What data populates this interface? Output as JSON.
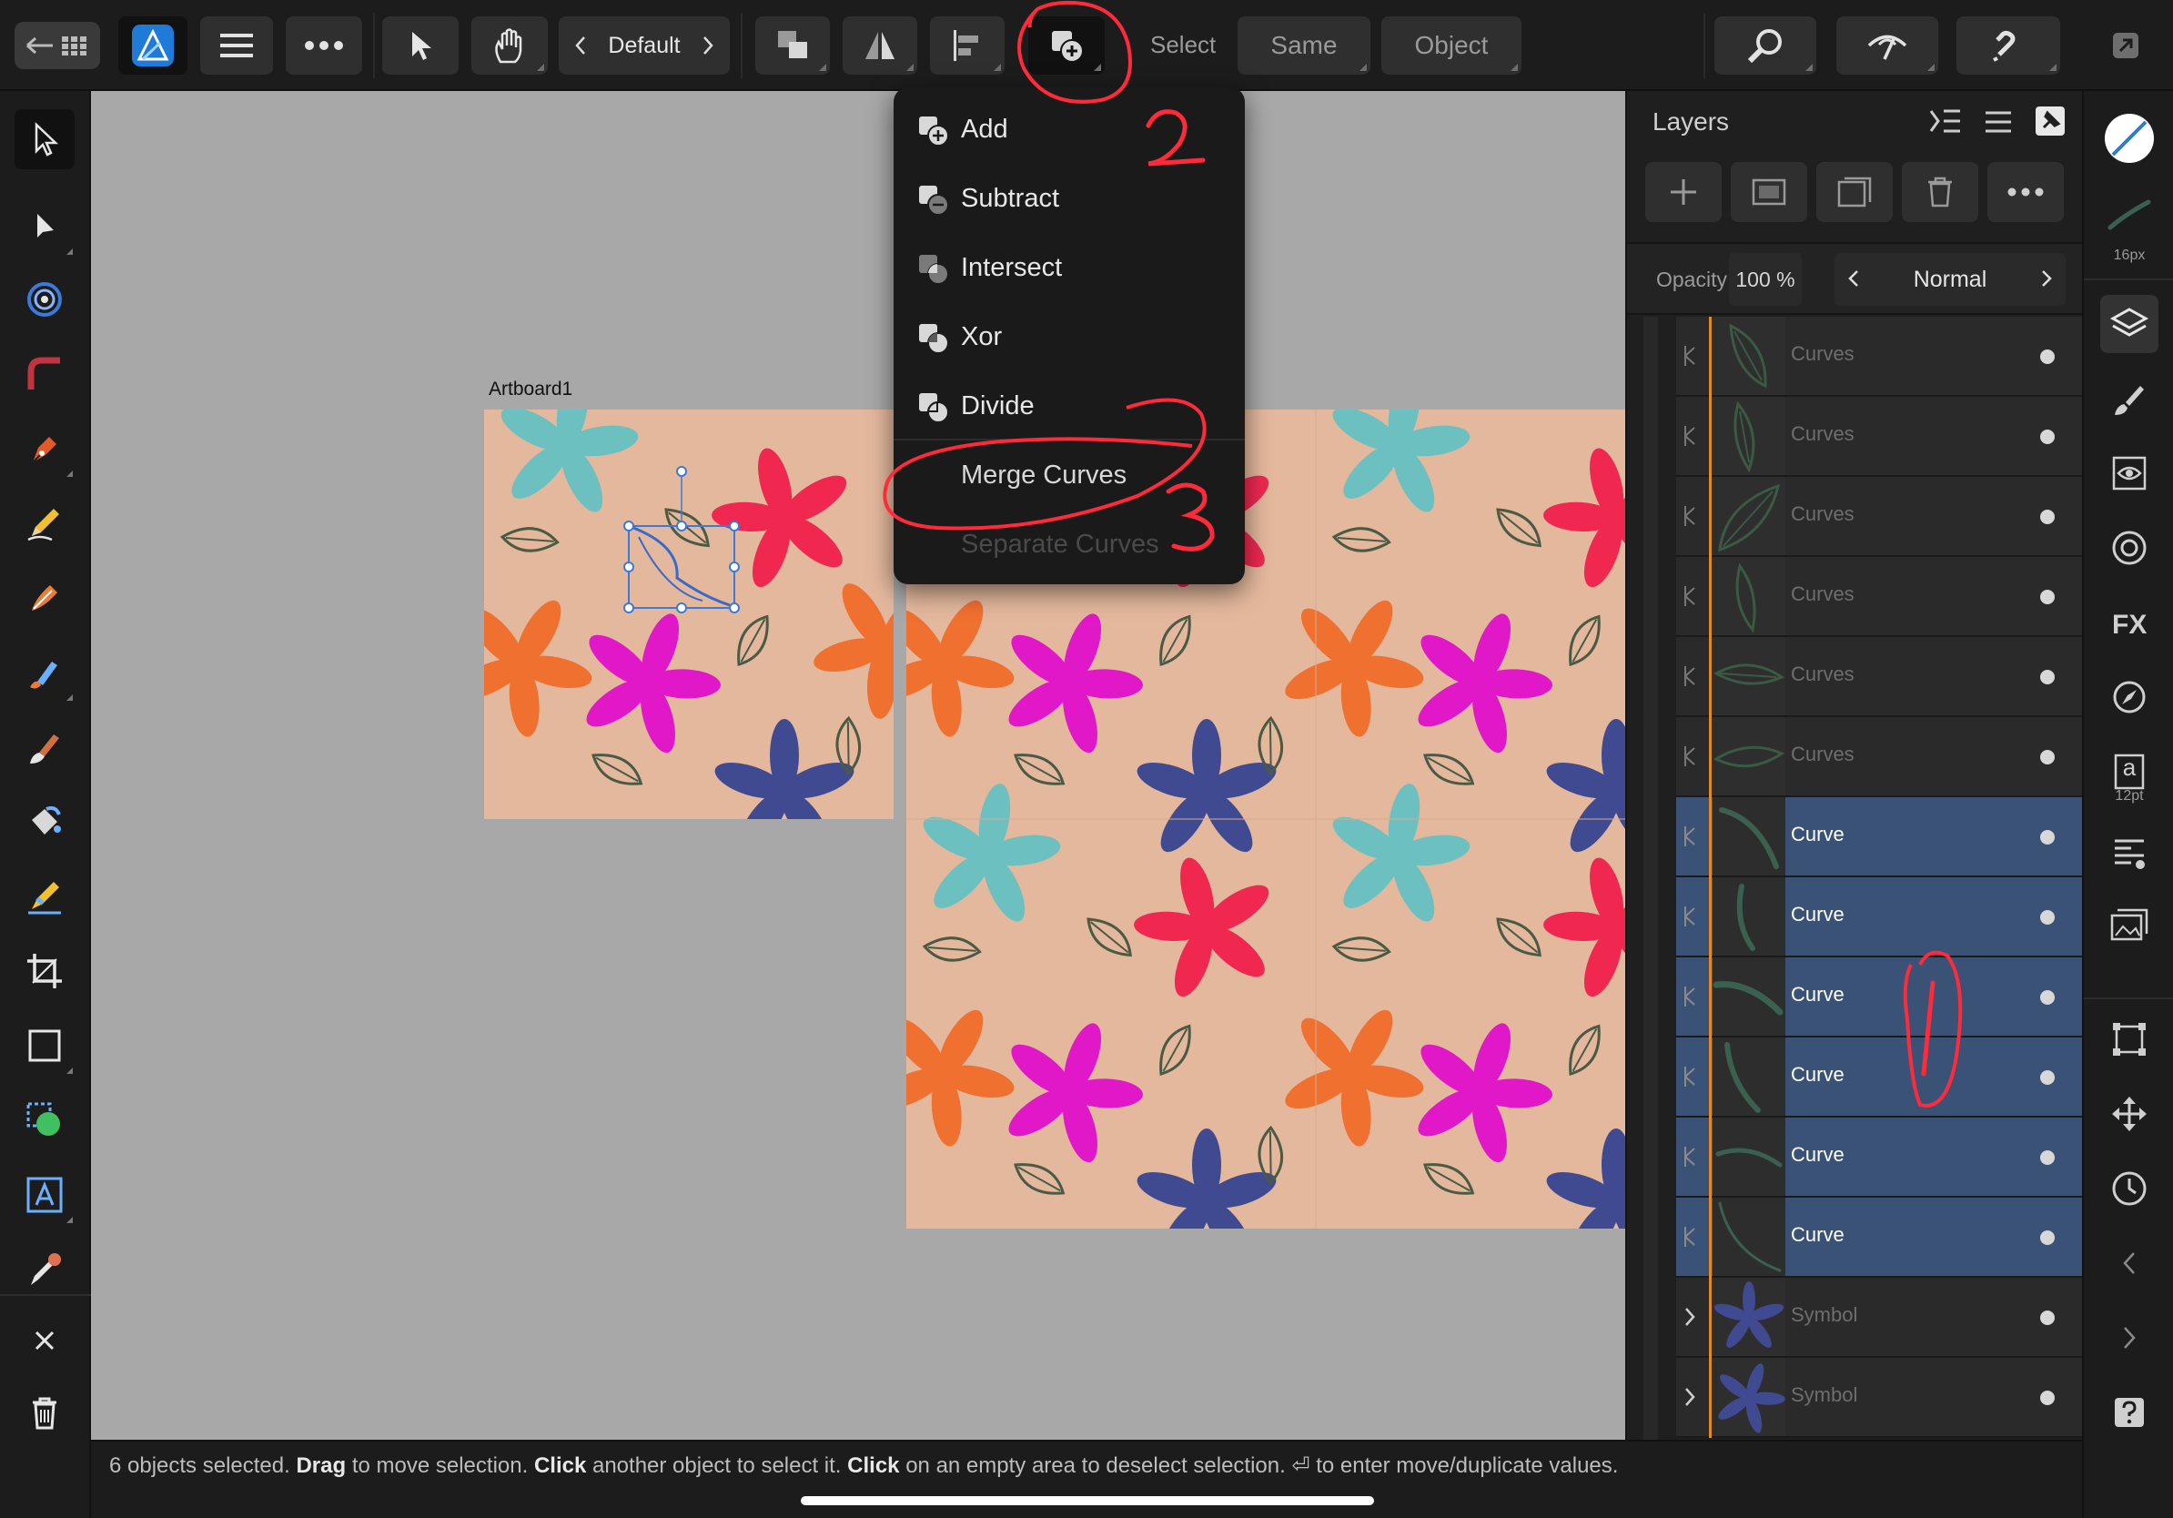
{
  "toolbar": {
    "persona_label": "Default",
    "select_label": "Select",
    "same_label": "Same",
    "object_label": "Object"
  },
  "canvas": {
    "artboard_label": "Artboard1"
  },
  "boolean_menu": {
    "items": [
      {
        "label": "Add",
        "icon": "add-shapes-icon",
        "enabled": true
      },
      {
        "label": "Subtract",
        "icon": "subtract-shapes-icon",
        "enabled": true
      },
      {
        "label": "Intersect",
        "icon": "intersect-shapes-icon",
        "enabled": true
      },
      {
        "label": "Xor",
        "icon": "xor-shapes-icon",
        "enabled": true
      },
      {
        "label": "Divide",
        "icon": "divide-shapes-icon",
        "enabled": true
      },
      {
        "label": "Merge Curves",
        "icon": "",
        "enabled": true
      },
      {
        "label": "Separate Curves",
        "icon": "",
        "enabled": false
      }
    ]
  },
  "layers_panel": {
    "title": "Layers",
    "opacity_label": "Opacity",
    "opacity_value": "100 %",
    "blend_mode": "Normal",
    "layers": [
      {
        "name": "Curves",
        "selected": false,
        "expandable": false
      },
      {
        "name": "Curves",
        "selected": false,
        "expandable": false
      },
      {
        "name": "Curves",
        "selected": false,
        "expandable": false
      },
      {
        "name": "Curves",
        "selected": false,
        "expandable": false
      },
      {
        "name": "Curves",
        "selected": false,
        "expandable": false
      },
      {
        "name": "Curves",
        "selected": false,
        "expandable": false
      },
      {
        "name": "Curve",
        "selected": true,
        "expandable": false
      },
      {
        "name": "Curve",
        "selected": true,
        "expandable": false
      },
      {
        "name": "Curve",
        "selected": true,
        "expandable": false
      },
      {
        "name": "Curve",
        "selected": true,
        "expandable": false
      },
      {
        "name": "Curve",
        "selected": true,
        "expandable": false
      },
      {
        "name": "Curve",
        "selected": true,
        "expandable": false
      },
      {
        "name": "Symbol",
        "selected": false,
        "expandable": true
      },
      {
        "name": "Symbol",
        "selected": false,
        "expandable": true
      }
    ]
  },
  "studio": {
    "brush_size_label": "16px",
    "font_size_label": "12pt",
    "text_glyph": "a"
  },
  "status": {
    "count_text": "6 objects selected.",
    "drag_word": "Drag",
    "drag_text": "to move selection.",
    "click_word": "Click",
    "click_text": "another object to select it.",
    "click2_word": "Click",
    "click2_text": "on an empty area to deselect selection.",
    "enter_glyph": "⏎",
    "enter_text": "to enter move/duplicate values."
  },
  "annotations": [
    "1",
    "2",
    "3"
  ],
  "colors": {
    "accent_blue": "#3a5275",
    "pattern_bg": "#e4b89d",
    "annotation_red": "#ff2a3a"
  }
}
